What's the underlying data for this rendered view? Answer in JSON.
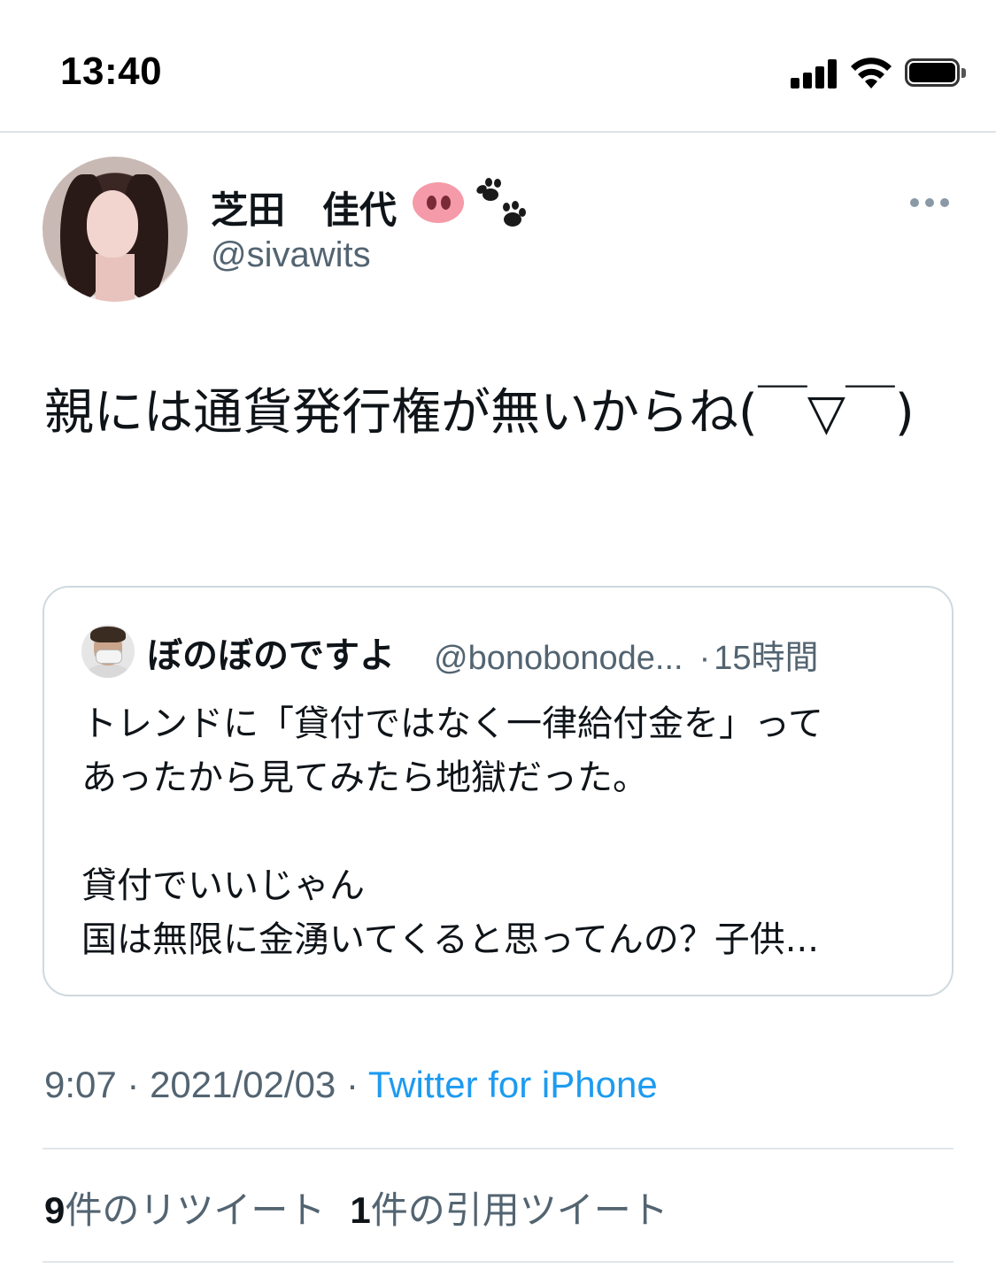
{
  "status_bar": {
    "time": "13:40"
  },
  "tweet": {
    "display_name": "芝田　佳代",
    "username": "@sivawits",
    "text": "親には通貨発行権が無いからね(￣▽￣)",
    "quoted": {
      "name": "ぼのぼのですよ",
      "handle": "@bonobonode...",
      "time_ago": "15時間",
      "lines": [
        "トレンドに「貸付ではなく一律給付金を」って",
        "あったから見てみたら地獄だった。",
        "",
        "貸付でいいじゃん",
        "国は無限に金湧いてくると思ってんの？子供..."
      ]
    },
    "time": "9:07",
    "date": "2021/02/03",
    "source": "Twitter for iPhone",
    "retweet_count": "9",
    "retweet_label": "件のリツイート",
    "quote_count": "1",
    "quote_label": "件の引用ツイート"
  },
  "icons": {
    "name_emoji_1": "pig-nose-icon",
    "name_emoji_2": "paw-prints-icon",
    "more": "more-horizontal-icon"
  },
  "colors": {
    "accent": "#1d9bf0",
    "secondary_text": "#536471",
    "primary_text": "#0f1419",
    "border": "#cfd9de"
  }
}
